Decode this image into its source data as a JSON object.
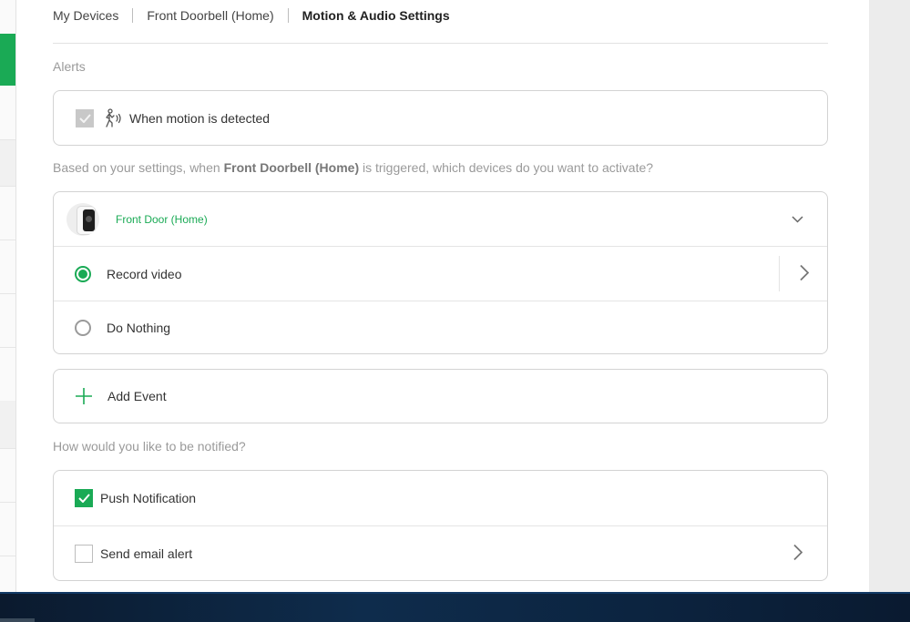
{
  "breadcrumb": {
    "items": [
      "My Devices",
      "Front Doorbell (Home)",
      "Motion & Audio Settings"
    ]
  },
  "alerts": {
    "section_label": "Alerts",
    "motion_label": "When motion is detected"
  },
  "trigger_prompt": {
    "prefix": "Based on your settings, when ",
    "device": "Front Doorbell (Home)",
    "suffix": " is triggered, which devices do you want to activate?"
  },
  "device_card": {
    "device_name": "Front Door (Home)",
    "options": [
      "Record video",
      "Do Nothing"
    ],
    "selected_option": "Record video"
  },
  "add_event": {
    "label": "Add Event"
  },
  "notify": {
    "section_label": "How would you like to be notified?",
    "push_label": "Push Notification",
    "push_checked": true,
    "email_label": "Send email alert",
    "email_checked": false
  },
  "colors": {
    "accent": "#1aaa55",
    "muted_text": "#9a9a9a",
    "border": "#d3d3d3"
  },
  "icons": {
    "motion": "motion-person-icon",
    "add": "plus-icon",
    "expand": "chevron-down-icon",
    "open": "chevron-right-icon"
  }
}
